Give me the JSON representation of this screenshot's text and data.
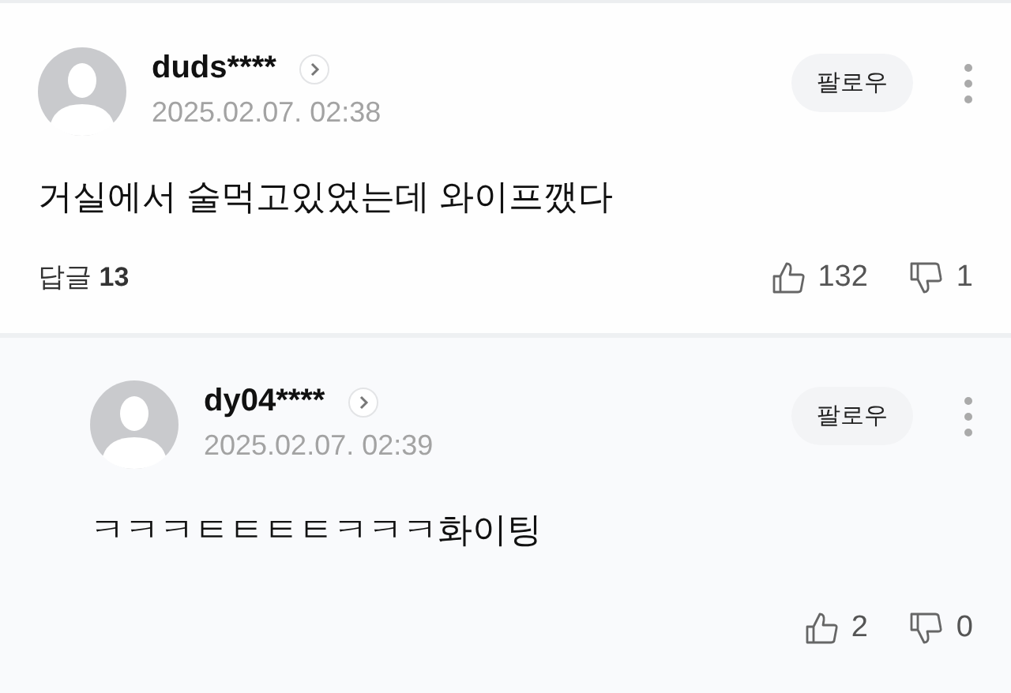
{
  "comments": [
    {
      "kind": "comment",
      "author": "duds****",
      "date": "2025.02.07. 02:38",
      "follow": "팔로우",
      "text": "거실에서 술먹고있었는데 와이프깼다",
      "replies_label": "답글",
      "replies_count": "13",
      "likes": "132",
      "dislikes": "1"
    },
    {
      "kind": "reply",
      "author": "dy04****",
      "date": "2025.02.07. 02:39",
      "follow": "팔로우",
      "text": "ㅋㅋㅋㅌㅌㅌㅌㅋㅋㅋ화이팅",
      "likes": "2",
      "dislikes": "0"
    }
  ]
}
